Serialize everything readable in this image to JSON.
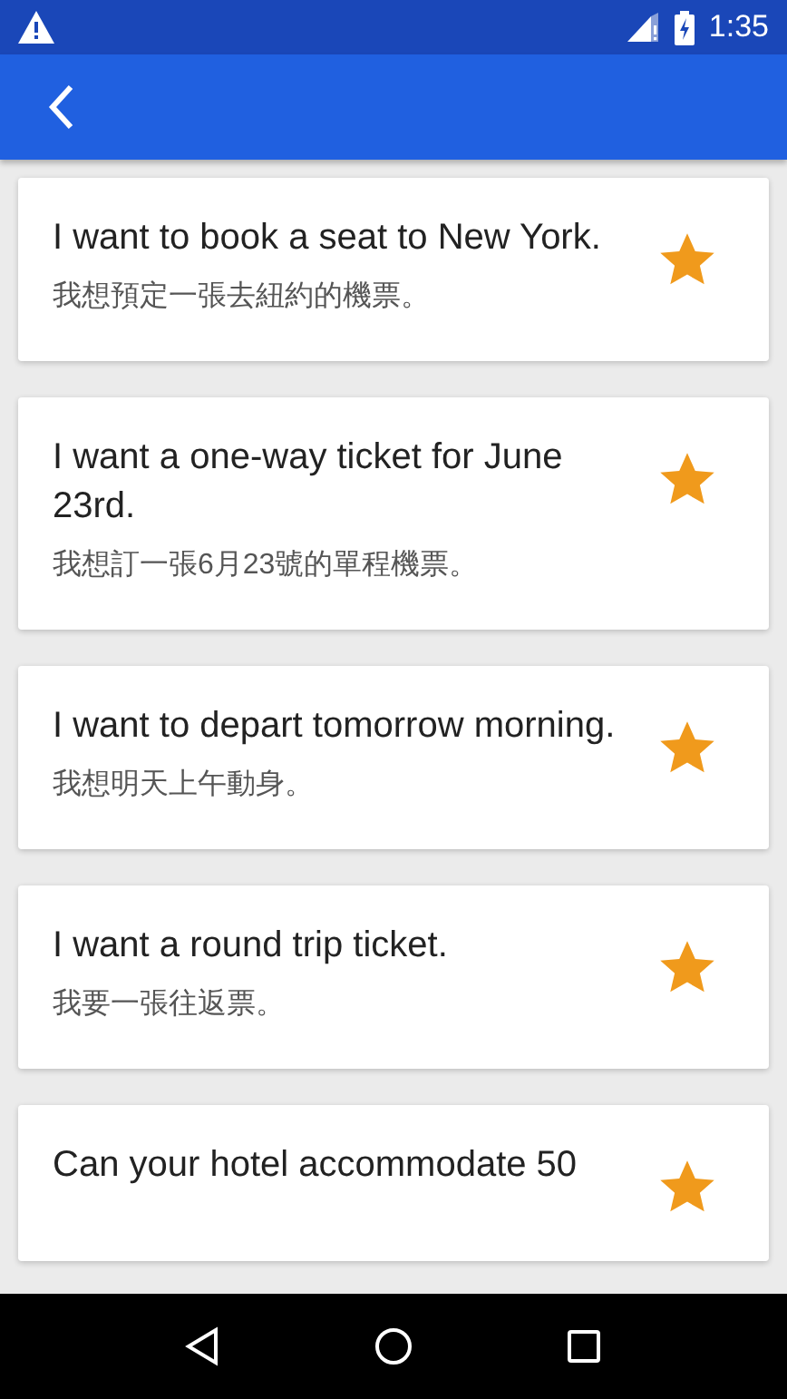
{
  "status_bar": {
    "time": "1:35"
  },
  "phrases": [
    {
      "english": "I want to book a seat to New York.",
      "chinese": "我想預定一張去紐約的機票。",
      "starred": true
    },
    {
      "english": "I want a one-way ticket for June 23rd.",
      "chinese": "我想訂一張6月23號的單程機票。",
      "starred": true
    },
    {
      "english": "I want to depart tomorrow morning.",
      "chinese": "我想明天上午動身。",
      "starred": true
    },
    {
      "english": "I want a round trip ticket.",
      "chinese": "我要一張往返票。",
      "starred": true
    },
    {
      "english": "Can your hotel accommodate 50",
      "starred": true
    }
  ]
}
